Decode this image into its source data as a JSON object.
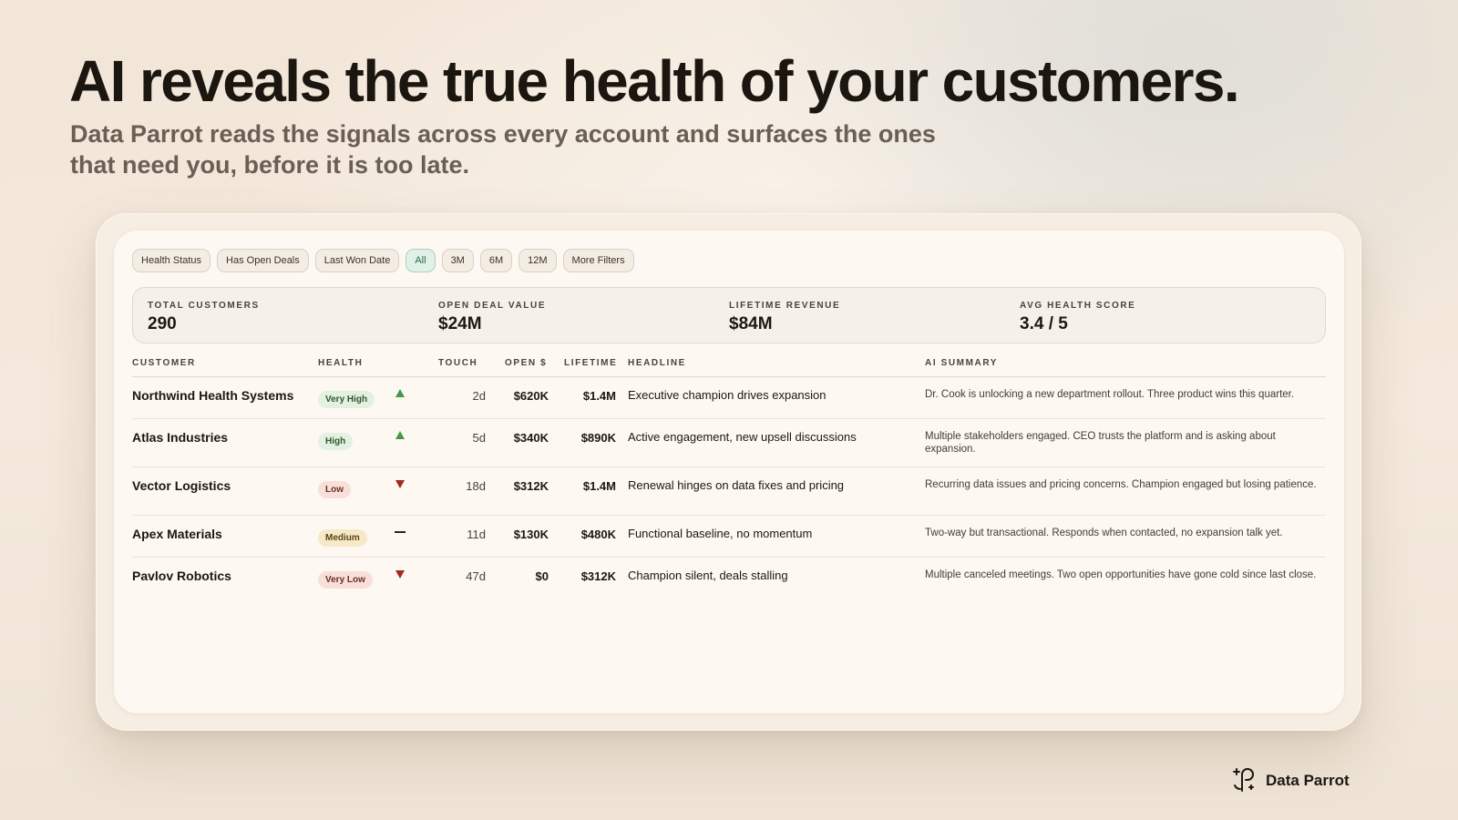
{
  "hero": {
    "title": "AI reveals the true health of your customers.",
    "subtitle": "Data Parrot reads the signals across every account and surfaces the ones that need you, before it is too late."
  },
  "filters": [
    {
      "label": "Health Status",
      "active": false
    },
    {
      "label": "Has Open Deals",
      "active": false
    },
    {
      "label": "Last Won Date",
      "active": false
    },
    {
      "label": "All",
      "active": true
    },
    {
      "label": "3M",
      "active": false
    },
    {
      "label": "6M",
      "active": false
    },
    {
      "label": "12M",
      "active": false
    },
    {
      "label": "More Filters",
      "active": false
    }
  ],
  "stats": [
    {
      "label": "TOTAL CUSTOMERS",
      "value": "290"
    },
    {
      "label": "OPEN DEAL VALUE",
      "value": "$24M"
    },
    {
      "label": "LIFETIME REVENUE",
      "value": "$84M"
    },
    {
      "label": "AVG HEALTH SCORE",
      "value": "3.4 / 5"
    }
  ],
  "table": {
    "columns": {
      "customer": "CUSTOMER",
      "health": "HEALTH",
      "touch": "TOUCH",
      "open": "OPEN $",
      "lifetime": "LIFETIME",
      "headline": "HEADLINE",
      "summary": "AI SUMMARY"
    },
    "rows": [
      {
        "customer": "Northwind Health Systems",
        "health": "Very High",
        "trend": "up",
        "touch": "2d",
        "open": "$620K",
        "lifetime": "$1.4M",
        "headline": "Executive champion drives expansion",
        "summary": "Dr. Cook is unlocking a new department rollout. Three product wins this quarter."
      },
      {
        "customer": "Atlas Industries",
        "health": "High",
        "trend": "up",
        "touch": "5d",
        "open": "$340K",
        "lifetime": "$890K",
        "headline": "Active engagement, new upsell discussions",
        "summary": "Multiple stakeholders engaged. CEO trusts the platform and is asking about expansion."
      },
      {
        "customer": "Vector Logistics",
        "health": "Low",
        "trend": "down",
        "touch": "18d",
        "open": "$312K",
        "lifetime": "$1.4M",
        "headline": "Renewal hinges on data fixes and pricing",
        "summary": "Recurring data issues and pricing concerns. Champion engaged but losing patience."
      },
      {
        "customer": "Apex Materials",
        "health": "Medium",
        "trend": "flat",
        "touch": "11d",
        "open": "$130K",
        "lifetime": "$480K",
        "headline": "Functional baseline, no momentum",
        "summary": "Two-way but transactional. Responds when contacted, no expansion talk yet."
      },
      {
        "customer": "Pavlov Robotics",
        "health": "Very Low",
        "trend": "down",
        "touch": "47d",
        "open": "$0",
        "lifetime": "$312K",
        "headline": "Champion silent, deals stalling",
        "summary": "Multiple canceled meetings. Two open opportunities have gone cold since last close."
      }
    ]
  },
  "brand": {
    "name": "Data Parrot",
    "icon": "parrot-logo-icon"
  },
  "colors": {
    "health_very_high_bg": "#e4f0e2",
    "health_very_high_fg": "#2d5a2a",
    "health_high_bg": "#e4f0e2",
    "health_high_fg": "#2d5a2a",
    "health_medium_bg": "#f6e9c7",
    "health_medium_fg": "#5c4514",
    "health_low_bg": "#f8e0da",
    "health_low_fg": "#6e2e22",
    "health_very_low_bg": "#f8e0da",
    "health_very_low_fg": "#6e2e22",
    "trend_up": "#3f9a4a",
    "trend_down": "#a32824",
    "trend_flat": "#2a2520"
  }
}
